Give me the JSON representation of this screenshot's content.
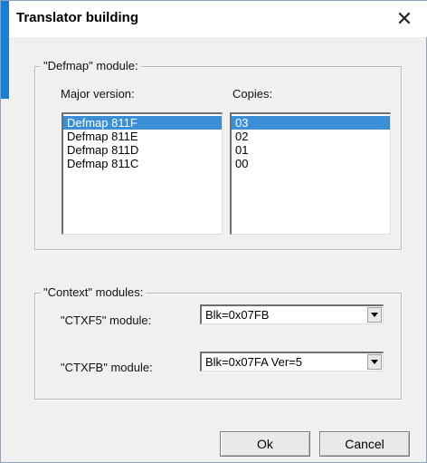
{
  "window": {
    "title": "Translator building",
    "close_glyph": "✕"
  },
  "defmap": {
    "group_label": "\"Defmap\" module:",
    "major_label": "Major version:",
    "copies_label": "Copies:",
    "major_items": [
      "Defmap 811F",
      "Defmap 811E",
      "Defmap 811D",
      "Defmap 811C"
    ],
    "major_selected": 0,
    "copies_items": [
      "03",
      "02",
      "01",
      "00"
    ],
    "copies_selected": 0
  },
  "context": {
    "group_label": "\"Context\" modules:",
    "ctxf5_label": "\"CTXF5\" module:",
    "ctxf5_value": "Blk=0x07FB",
    "ctxfb_label": "\"CTXFB\" module:",
    "ctxfb_value": "Blk=0x07FA Ver=5"
  },
  "buttons": {
    "ok_label": "Ok",
    "cancel_label": "Cancel"
  },
  "colors": {
    "accent": "#1a7fd1",
    "selection": "#3b8fd6"
  },
  "icons": {
    "close": "close-icon",
    "dropdown": "chevron-down-icon"
  }
}
